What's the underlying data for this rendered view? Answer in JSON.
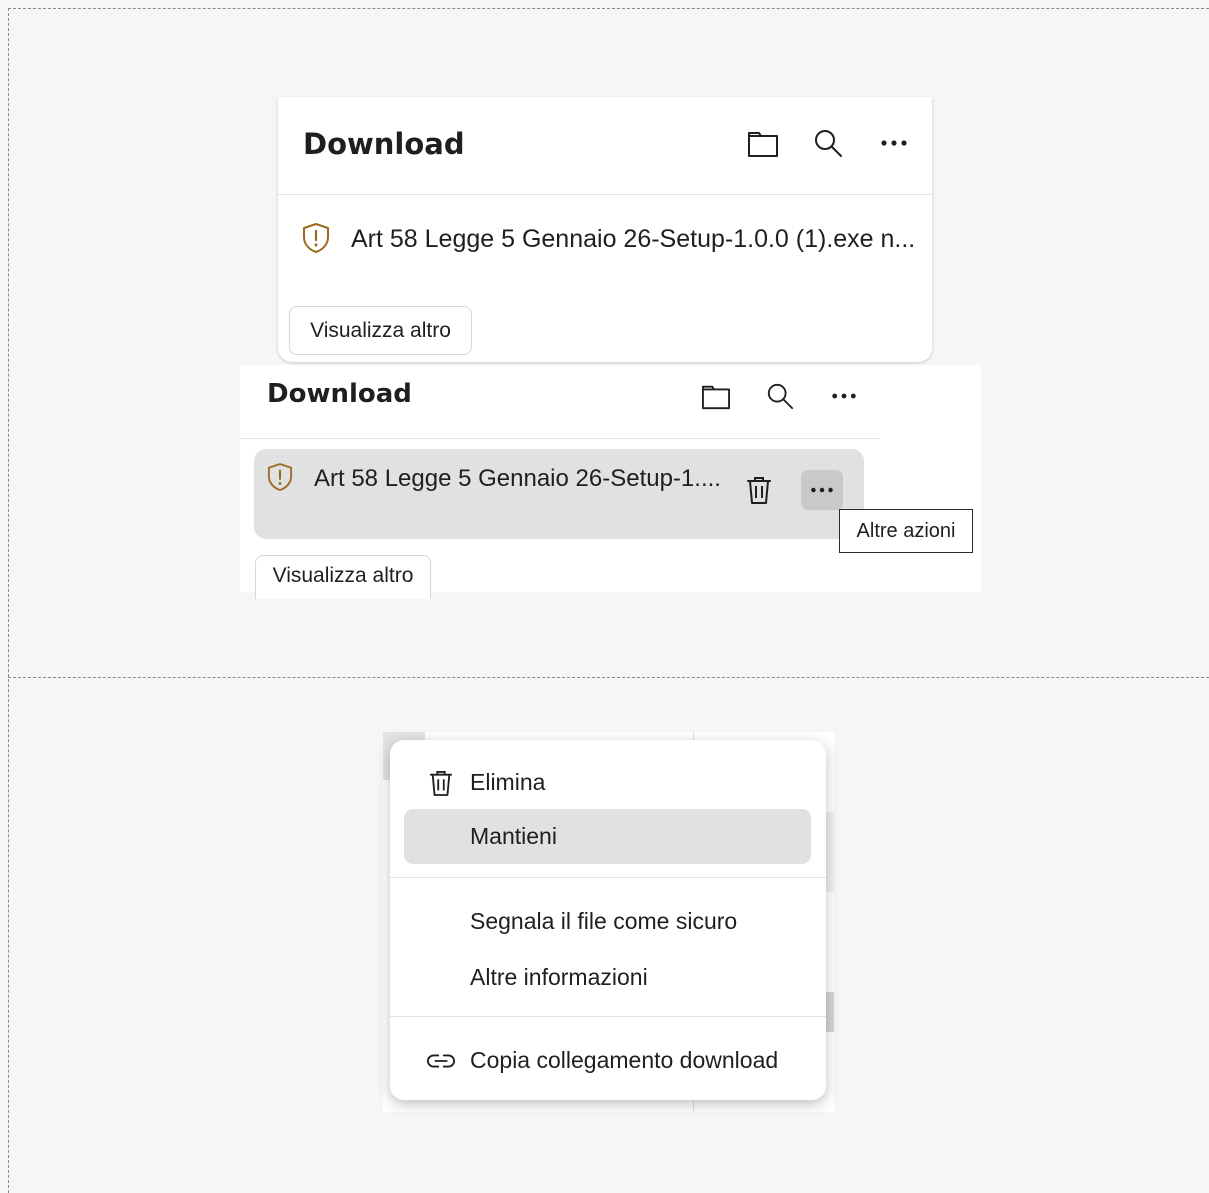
{
  "panel_top": {
    "title": "Download",
    "item": {
      "filename": "Art 58 Legge 5 Gennaio 26-Setup-1.0.0 (1).exe n..."
    },
    "see_more_label": "Visualizza altro",
    "icons": [
      "folder-icon",
      "search-icon",
      "more-icon",
      "shield-warning-icon"
    ]
  },
  "panel_hover": {
    "title": "Download",
    "item": {
      "filename": "Art 58 Legge 5 Gennaio 26-Setup-1...."
    },
    "tooltip": "Altre azioni",
    "see_more_label": "Visualizza altro",
    "icons": [
      "folder-icon",
      "search-icon",
      "more-icon",
      "shield-warning-icon",
      "trash-icon"
    ]
  },
  "context_menu": {
    "items": [
      {
        "label": "Elimina",
        "icon": "trash-icon"
      },
      {
        "label": "Mantieni",
        "highlighted": true
      },
      {
        "label": "Segnala il file come sicuro"
      },
      {
        "label": "Altre informazioni"
      },
      {
        "label": "Copia collegamento download",
        "icon": "link-icon"
      }
    ]
  },
  "colors": {
    "warning": "#9a6a1f",
    "highlight": "#e1e1e1",
    "more_hover": "#c9c9c9"
  }
}
